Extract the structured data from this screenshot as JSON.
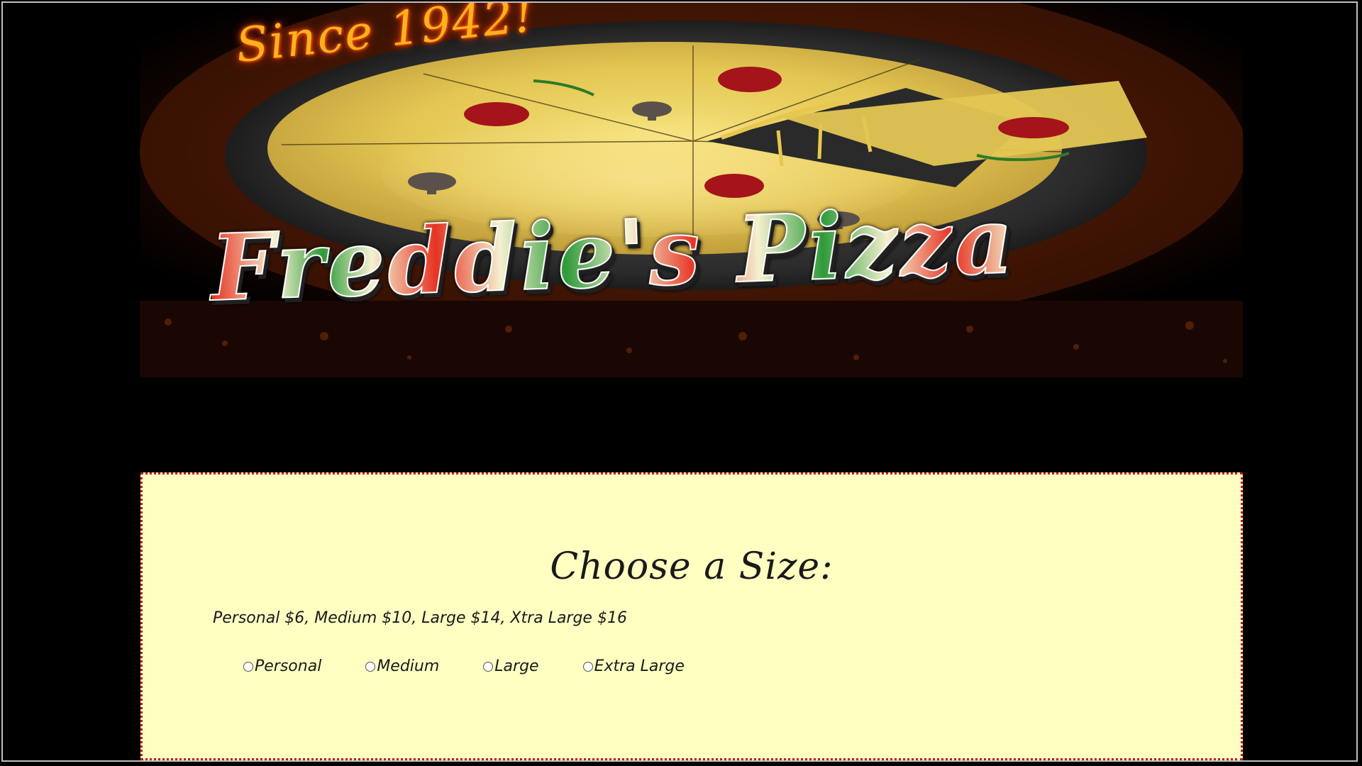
{
  "banner": {
    "tagline": "Since 1942!",
    "logo_text": "Freddie's Pizza"
  },
  "size_panel": {
    "title": "Choose a Size:",
    "price_list": "Personal $6, Medium $10, Large $14, Xtra Large $16",
    "options": [
      {
        "label": "Personal",
        "selected": false
      },
      {
        "label": "Medium",
        "selected": false
      },
      {
        "label": "Large",
        "selected": false
      },
      {
        "label": "Extra Large",
        "selected": false
      }
    ]
  },
  "colors": {
    "page_background": "#000000",
    "panel_background": "#ffffc2",
    "panel_border": "#c21a1a",
    "tagline": "#ffb21c",
    "logo_red": "#e63323",
    "logo_green": "#2f9a3a",
    "logo_cream": "#f4f1d0"
  }
}
